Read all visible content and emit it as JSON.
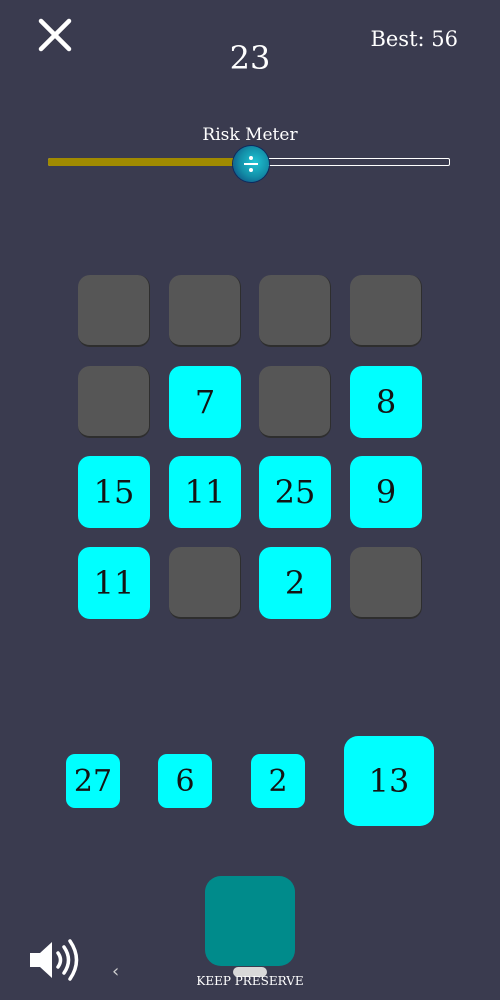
{
  "header": {
    "score": "23",
    "best": "Best: 56"
  },
  "risk_meter": {
    "label": "Risk Meter",
    "level": 0.5,
    "fill_color": "#a08a00",
    "thumb_icon": "divide-icon"
  },
  "board": {
    "rows": [
      [
        "",
        "",
        "",
        ""
      ],
      [
        "",
        "7",
        "",
        "8"
      ],
      [
        "15",
        "11",
        "25",
        "9"
      ],
      [
        "11",
        "",
        "2",
        ""
      ]
    ],
    "empty_color": "#565656",
    "filled_color": "#00ffff"
  },
  "hand": {
    "tiles": [
      "27",
      "6",
      "2",
      "13"
    ],
    "selected_index": 3
  },
  "action": {
    "label": "KEEP PRESERVE",
    "color": "#008b8b"
  },
  "icons": {
    "close": "close-icon",
    "sound": "speaker-icon",
    "back": "chevron-left-icon"
  },
  "nav": {
    "back_glyph": "‹"
  },
  "colors": {
    "background": "#3a3b4f",
    "tile_text": "#141414"
  }
}
